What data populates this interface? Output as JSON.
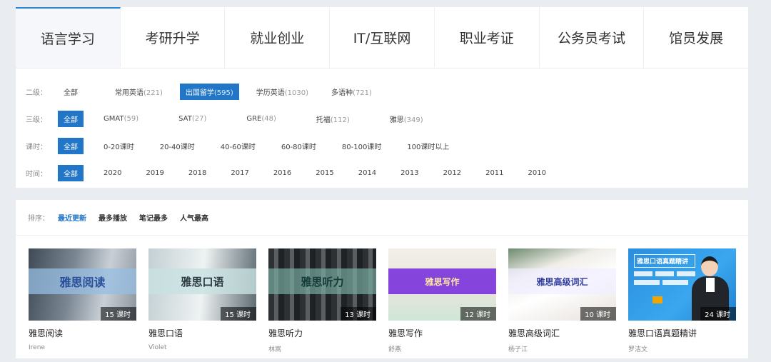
{
  "tabs": [
    "语言学习",
    "考研升学",
    "就业创业",
    "IT/互联网",
    "职业考证",
    "公务员考试",
    "馆员发展"
  ],
  "filters": {
    "level2": {
      "label": "二级：",
      "options": [
        {
          "text": "全部",
          "count": ""
        },
        {
          "text": "常用英语",
          "count": "(221)"
        },
        {
          "text": "出国留学",
          "count": "(595)"
        },
        {
          "text": "学历英语",
          "count": "(1030)"
        },
        {
          "text": "多语种",
          "count": "(721)"
        }
      ]
    },
    "level3": {
      "label": "三级：",
      "options": [
        {
          "text": "全部",
          "count": ""
        },
        {
          "text": "GMAT",
          "count": "(59)"
        },
        {
          "text": "SAT",
          "count": "(27)"
        },
        {
          "text": "GRE",
          "count": "(48)"
        },
        {
          "text": "托福",
          "count": "(112)"
        },
        {
          "text": "雅思",
          "count": "(349)"
        }
      ]
    },
    "hours": {
      "label": "课时：",
      "options": [
        "全部",
        "0-20课时",
        "20-40课时",
        "40-60课时",
        "60-80课时",
        "80-100课时",
        "100课时以上"
      ]
    },
    "time": {
      "label": "时间：",
      "options": [
        "全部",
        "2020",
        "2019",
        "2018",
        "2017",
        "2016",
        "2015",
        "2014",
        "2013",
        "2012",
        "2011",
        "2010"
      ]
    }
  },
  "sort": {
    "label": "排序：",
    "options": [
      "最近更新",
      "最多播放",
      "笔记最多",
      "人气最高"
    ]
  },
  "courses": [
    {
      "banner": "雅思阅读",
      "lessons": "15 课时",
      "title": "雅思阅读",
      "teacher": "Irene"
    },
    {
      "banner": "雅思口语",
      "lessons": "15 课时",
      "title": "雅思口语",
      "teacher": "Violet"
    },
    {
      "banner": "雅思听力",
      "lessons": "13 课时",
      "title": "雅思听力",
      "teacher": "林嵩"
    },
    {
      "banner": "雅思写作",
      "lessons": "12 课时",
      "title": "雅思写作",
      "teacher": "舒燕"
    },
    {
      "banner": "雅思高级词汇",
      "lessons": "10 课时",
      "title": "雅思高级词汇",
      "teacher": "杨子江"
    },
    {
      "banner": "雅思口语真题精讲",
      "lessons": "24 课时",
      "title": "雅思口语真题精讲",
      "teacher": "罗洁文"
    }
  ],
  "colors": {
    "accent": "#2176c7",
    "tab_active_bar": "#2d86d2"
  }
}
